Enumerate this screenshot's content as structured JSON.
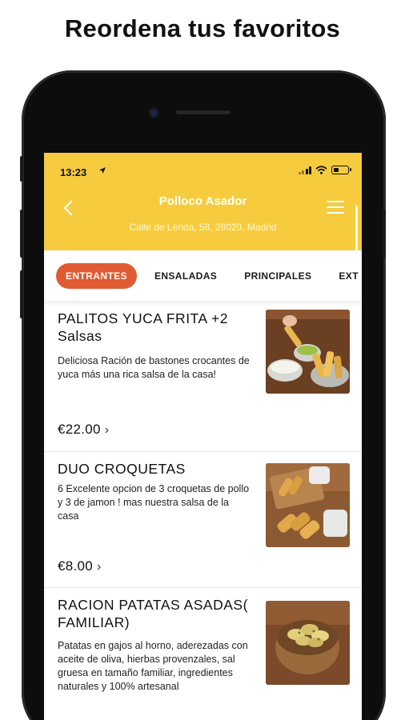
{
  "promo": {
    "title": "Reordena tus favoritos"
  },
  "status_bar": {
    "time": "13:23",
    "location_icon": "navigation-arrow-icon"
  },
  "header": {
    "restaurant_name": "Polloco Asador",
    "address": "Calle de Lérida, 58, 28020, Madrid",
    "background_color": "#f6cc3e"
  },
  "tabs": [
    {
      "label": "ENTRANTES",
      "active": true
    },
    {
      "label": "ENSALADAS",
      "active": false
    },
    {
      "label": "PRINCIPALES",
      "active": false
    },
    {
      "label": "EXT",
      "active": false
    }
  ],
  "accent_color": "#e05a32",
  "items": [
    {
      "name": "PALITOS YUCA FRITA +2 Salsas",
      "description": "Deliciosa Ración de bastones crocantes de yuca más una rica salsa de la casa!",
      "price": "€22.00"
    },
    {
      "name": "DUO CROQUETAS",
      "description": "6 Excelente opcion de 3 croquetas de pollo y 3 de jamon ! mas nuestra salsa de la casa",
      "price": "€8.00"
    },
    {
      "name": "RACION PATATAS ASADAS( FAMILIAR)",
      "description": " Patatas en gajos al horno, aderezadas con aceite de oliva, hierbas provenzales, sal gruesa en tamaño familiar, ingredientes naturales y 100% artesanal",
      "price": ""
    }
  ]
}
